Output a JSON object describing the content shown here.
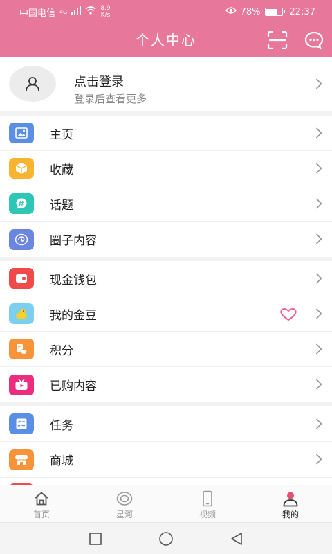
{
  "status": {
    "carrier": "中国电信",
    "network": "4G",
    "speed_value": "8.9",
    "speed_unit": "K/s",
    "battery": "78%",
    "battery_level": 0.78,
    "time": "22:37"
  },
  "header": {
    "title": "个人中心",
    "scan_icon": "scan-icon",
    "message_icon": "message-icon"
  },
  "login": {
    "title": "点击登录",
    "subtitle": "登录后查看更多"
  },
  "groups": [
    [
      {
        "label": "主页",
        "icon": "image-icon",
        "color": "#5b8fe6"
      },
      {
        "label": "收藏",
        "icon": "box-icon",
        "color": "#f7b430"
      },
      {
        "label": "话题",
        "icon": "hashtag-icon",
        "color": "#2ec7b6"
      },
      {
        "label": "圈子内容",
        "icon": "circle-swirl-icon",
        "color": "#6b86e0"
      }
    ],
    [
      {
        "label": "现金钱包",
        "icon": "wallet-icon",
        "color": "#f04a4a"
      },
      {
        "label": "我的金豆",
        "icon": "duck-icon",
        "color": "#7ccfef"
      },
      {
        "label": "积分",
        "icon": "coins-icon",
        "color": "#f7943a"
      },
      {
        "label": "已购内容",
        "icon": "tv-icon",
        "color": "#ec2c7c"
      }
    ],
    [
      {
        "label": "任务",
        "icon": "checklist-icon",
        "color": "#5b8fe6"
      },
      {
        "label": "商城",
        "icon": "shop-icon",
        "color": "#f7943a"
      }
    ]
  ],
  "tabs": [
    {
      "label": "首页",
      "icon": "home-icon",
      "active": false
    },
    {
      "label": "星河",
      "icon": "galaxy-icon",
      "active": false
    },
    {
      "label": "视频",
      "icon": "phone-video-icon",
      "active": false
    },
    {
      "label": "我的",
      "icon": "user-icon",
      "active": true
    }
  ],
  "colors": {
    "brand": "#e8789b",
    "active_tab_icon": "#e8506f"
  }
}
